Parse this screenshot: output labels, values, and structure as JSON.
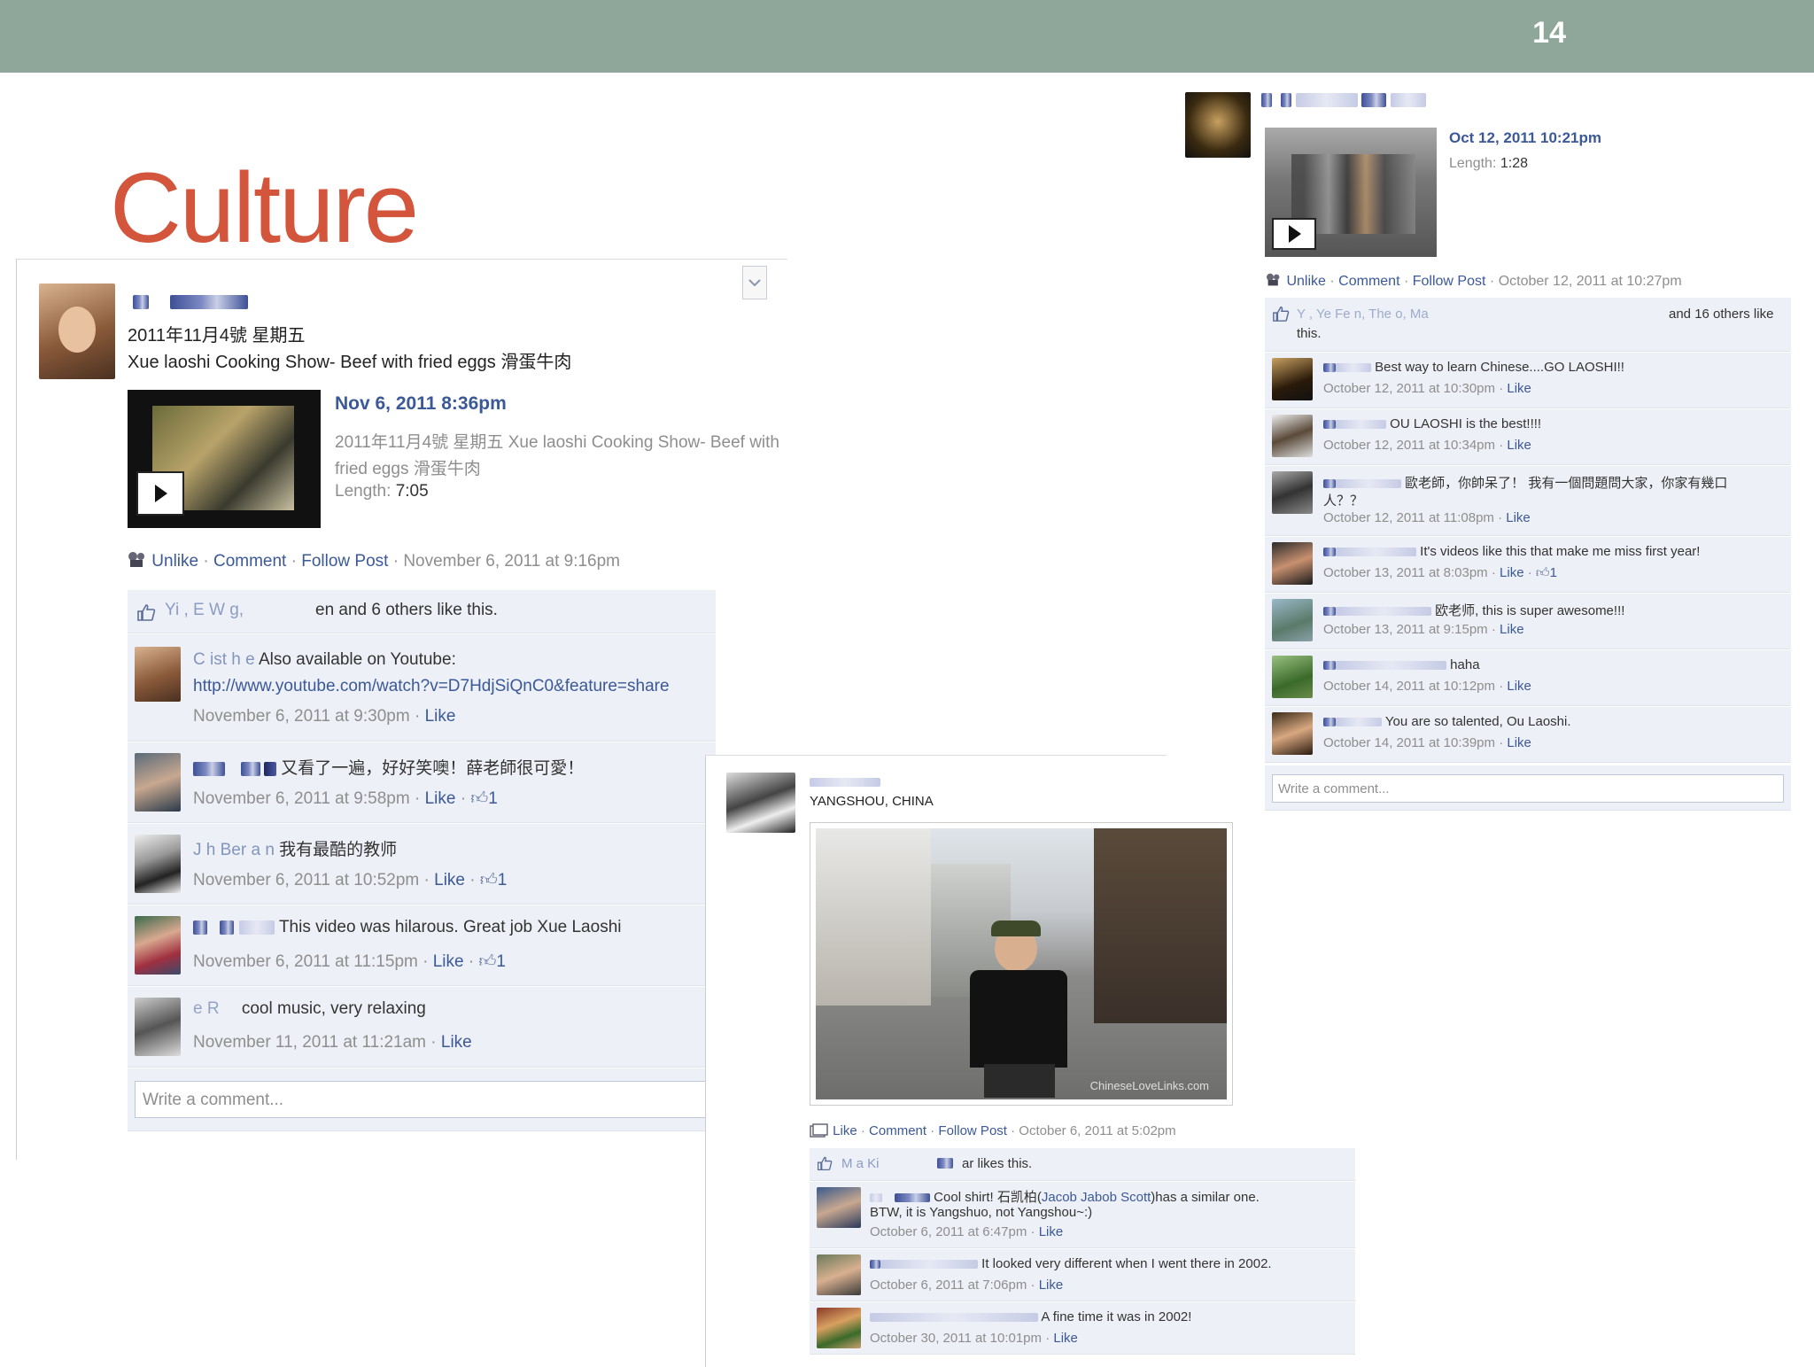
{
  "slide": {
    "number": "14",
    "title": "Culture"
  },
  "post1": {
    "date_line": "2011年11月4號 星期五",
    "post_text": "Xue laoshi Cooking Show- Beef with fried eggs 滑蛋牛肉",
    "video_date": "Nov 6, 2011 8:36pm",
    "video_desc_1": "2011年11月4號 星期五 Xue laoshi Cooking Show- Beef with",
    "video_desc_2": "fried eggs 滑蛋牛肉",
    "length_label": "Length:",
    "length_value": "7:05",
    "actions": [
      "Unlike",
      "Comment",
      "Follow Post"
    ],
    "actions_time": "November 6, 2011 at 9:16pm",
    "likes_text": "en and 6 others like this.",
    "likes_prefix": "Yi , E  W  g,",
    "comments": [
      {
        "name": "C  ist   h   e",
        "text": "Also available on Youtube:",
        "text2": "http://www.youtube.com/watch?v=D7HdjSiQnC0&feature=share",
        "time": "November 6, 2011 at 9:30pm",
        "like": "Like",
        "count": ""
      },
      {
        "name": "",
        "text": "又看了一遍，好好笑噢！薛老師很可愛！",
        "text2": "",
        "time": "November 6, 2011 at 9:58pm",
        "like": "Like",
        "count": "1"
      },
      {
        "name": "J  h  Ber  a  n",
        "text": "我有最酷的教师",
        "text2": "",
        "time": "November 6, 2011 at 10:52pm",
        "like": "Like",
        "count": "1"
      },
      {
        "name": "",
        "text": "This video was hilarous. Great job Xue Laoshi",
        "text2": "",
        "time": "November 6, 2011 at 11:15pm",
        "like": "Like",
        "count": "1"
      },
      {
        "name": "e R",
        "text": "cool music, very relaxing",
        "text2": "",
        "time": "November 11, 2011 at 11:21am",
        "like": "Like",
        "count": ""
      }
    ],
    "comment_placeholder": "Write a comment..."
  },
  "post2": {
    "video_date": "Oct 12, 2011 10:21pm",
    "length_label": "Length:",
    "length_value": "1:28",
    "actions": [
      "Unlike",
      "Comment",
      "Follow Post"
    ],
    "actions_time": "October 12, 2011 at 10:27pm",
    "likes_text": "and 16 others like",
    "likes_text2": "this.",
    "likes_prefix": "Y  , Ye  Fe  n, The  o, Ma",
    "comments": [
      {
        "text": "Best way to learn Chinese....GO LAOSHI!!",
        "time": "October 12, 2011 at 10:30pm",
        "like": "Like",
        "count": ""
      },
      {
        "text": "OU LAOSHI is the best!!!!",
        "time": "October 12, 2011 at 10:34pm",
        "like": "Like",
        "count": ""
      },
      {
        "text": "歐老師，你帥呆了！ 我有一個問題問大家，你家有幾口",
        "text2": "人？？",
        "time": "October 12, 2011 at 11:08pm",
        "like": "Like",
        "count": ""
      },
      {
        "text": "It's videos like this that make me miss first year!",
        "time": "October 13, 2011 at 8:03pm",
        "like": "Like",
        "count": "1"
      },
      {
        "text": "欧老师, this is super awesome!!!",
        "time": "October 13, 2011 at 9:15pm",
        "like": "Like",
        "count": ""
      },
      {
        "text": "haha",
        "time": "October 14, 2011 at 10:12pm",
        "like": "Like",
        "count": ""
      },
      {
        "text": "You are so talented, Ou Laoshi.",
        "time": "October 14, 2011 at 10:39pm",
        "like": "Like",
        "count": ""
      }
    ],
    "comment_placeholder": "Write a comment..."
  },
  "post3": {
    "location": "YANGSHOU, CHINA",
    "watermark": "ChineseLoveLinks.com",
    "actions": [
      "Like",
      "Comment",
      "Follow Post"
    ],
    "actions_time": "October 6, 2011 at 5:02pm",
    "likes_text": "ar likes this.",
    "likes_prefix": "M  a Ki",
    "comments": [
      {
        "text": "Cool shirt! 石凯柏(",
        "link": "Jacob Jabob Scott",
        "text_after": ")has a similar one.",
        "text2": "BTW, it is Yangshuo, not Yangshou~:)",
        "time": "October 6, 2011 at 6:47pm",
        "like": "Like"
      },
      {
        "text": "It looked very different when I went there in 2002.",
        "time": "October 6, 2011 at 7:06pm",
        "like": "Like"
      },
      {
        "text": "A fine time it was in 2002!",
        "time": "October 30, 2011 at 10:01pm",
        "like": "Like"
      }
    ]
  },
  "icons": {
    "play": "play-icon",
    "thumb": "thumbs-up-icon",
    "chevron": "chevron-down-icon"
  }
}
